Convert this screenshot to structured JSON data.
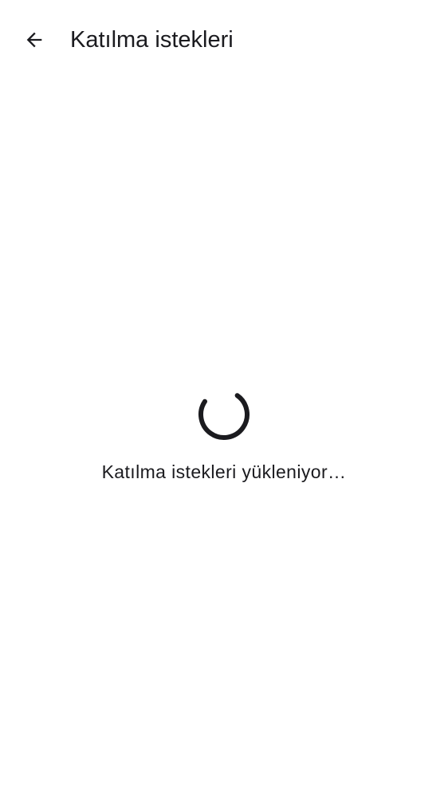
{
  "header": {
    "back_icon": "arrow-back-icon",
    "title": "Katılma istekleri"
  },
  "loading": {
    "spinner_icon": "progress-spinner-icon",
    "message": "Katılma istekleri yükleniyor…"
  },
  "colors": {
    "text": "#1b1b1f",
    "background": "#ffffff",
    "spinner": "#1b1b1f"
  }
}
